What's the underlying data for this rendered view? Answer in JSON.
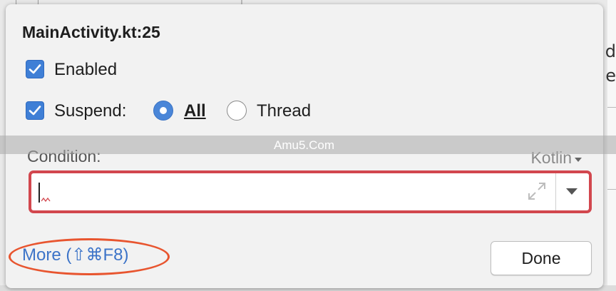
{
  "dialog": {
    "title": "MainActivity.kt:25",
    "enabled": {
      "label": "Enabled",
      "checked": true
    },
    "suspend": {
      "label": "Suspend:",
      "checked": true,
      "options": [
        {
          "label": "All",
          "selected": true
        },
        {
          "label": "Thread",
          "selected": false
        }
      ]
    },
    "condition": {
      "label": "Condition:",
      "language": "Kotlin",
      "value": ""
    },
    "more_link": "More (⇧⌘F8)",
    "done_button": "Done"
  },
  "watermark": "Amu5.Com",
  "colors": {
    "accent": "#3f7fd6",
    "error_border": "#d2474e",
    "link": "#3d74c8",
    "annotation": "#e8552f"
  },
  "icons": [
    "check-icon",
    "radio-selected",
    "radio-unselected",
    "expand-icon",
    "dropdown-arrow-icon",
    "chevron-down-icon"
  ]
}
